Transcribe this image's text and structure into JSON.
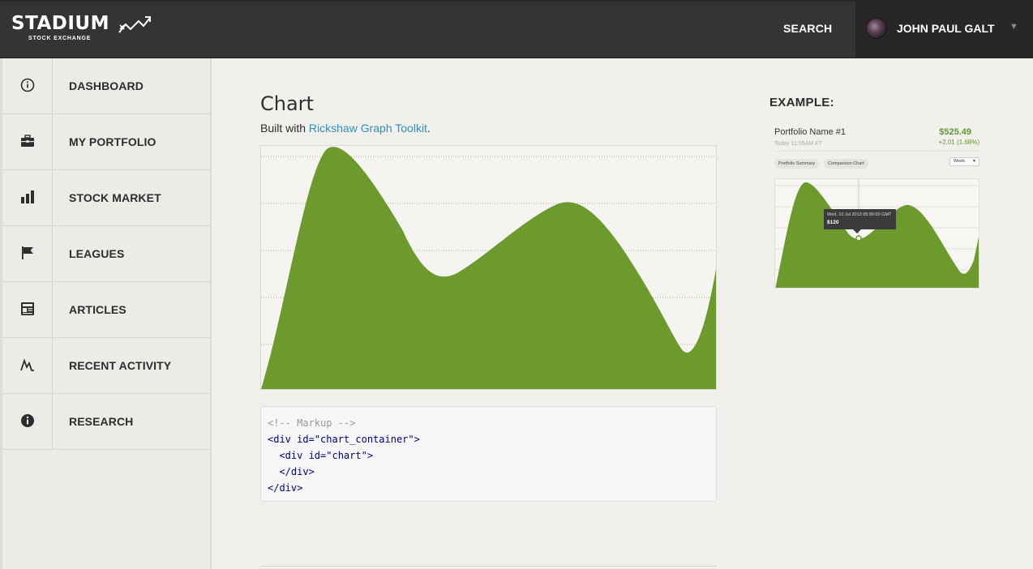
{
  "brand": {
    "name": "STADIUM",
    "tagline": "STOCK EXCHANGE"
  },
  "header": {
    "search_label": "SEARCH",
    "user_name": "JOHN PAUL GALT",
    "caret": "▼"
  },
  "sidebar": {
    "items": [
      {
        "label": "DASHBOARD",
        "icon": "info-circle-icon"
      },
      {
        "label": "MY PORTFOLIO",
        "icon": "briefcase-icon"
      },
      {
        "label": "STOCK MARKET",
        "icon": "bar-chart-icon"
      },
      {
        "label": "LEAGUES",
        "icon": "flag-icon"
      },
      {
        "label": "ARTICLES",
        "icon": "newspaper-icon"
      },
      {
        "label": "RECENT ACTIVITY",
        "icon": "activity-icon"
      },
      {
        "label": "RESEARCH",
        "icon": "info-filled-icon"
      }
    ]
  },
  "main": {
    "title": "Chart",
    "desc_prefix": "Built with ",
    "desc_link": "Rickshaw Graph Toolkit",
    "desc_suffix": ".",
    "code": [
      "<!-- Markup -->",
      "<div id=\"chart_container\">",
      "  <div id=\"chart\">",
      "  </div>",
      "</div>"
    ]
  },
  "example": {
    "heading": "EXAMPLE:",
    "portfolio_name": "Portfolio Name #1",
    "timestamp": "Today 11:05AM ET",
    "value": "$525.49",
    "change": "+2.01 (1.68%)",
    "tabs": [
      "Portfolio Summary",
      "Comparison Chart"
    ],
    "range_select": "Week",
    "tooltip_date": "Wed, 10 Jul 2013 05:00:00 GMT",
    "tooltip_value": "$120"
  },
  "colors": {
    "accent_green": "#6c9a2c",
    "link": "#2f8fbd",
    "topbar": "#343434"
  }
}
